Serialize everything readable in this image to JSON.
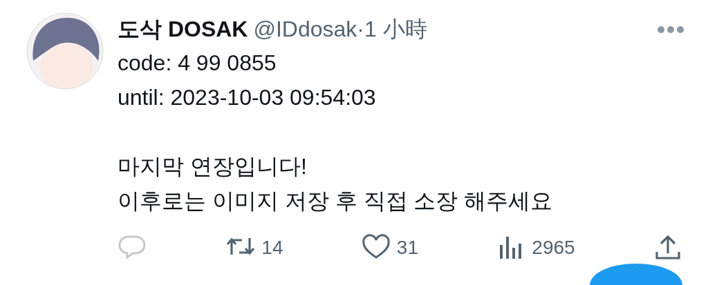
{
  "tweet": {
    "display_name": "도삭 DOSAK",
    "handle": "@IDdosak",
    "separator": "·",
    "time": "1 小時",
    "paragraphs": [
      [
        "code: 4 99 0855",
        "until: 2023-10-03 09:54:03"
      ],
      [
        "마지막 연장입니다!",
        "이후로는 이미지 저장 후 직접 소장 해주세요"
      ]
    ],
    "actions": [
      {
        "kind": "reply",
        "disabled": true
      },
      {
        "kind": "retweet",
        "count": "14",
        "disabled": false
      },
      {
        "kind": "like",
        "count": "31",
        "disabled": false
      },
      {
        "kind": "views",
        "count": "2965",
        "disabled": false
      },
      {
        "kind": "share",
        "disabled": false
      }
    ]
  }
}
